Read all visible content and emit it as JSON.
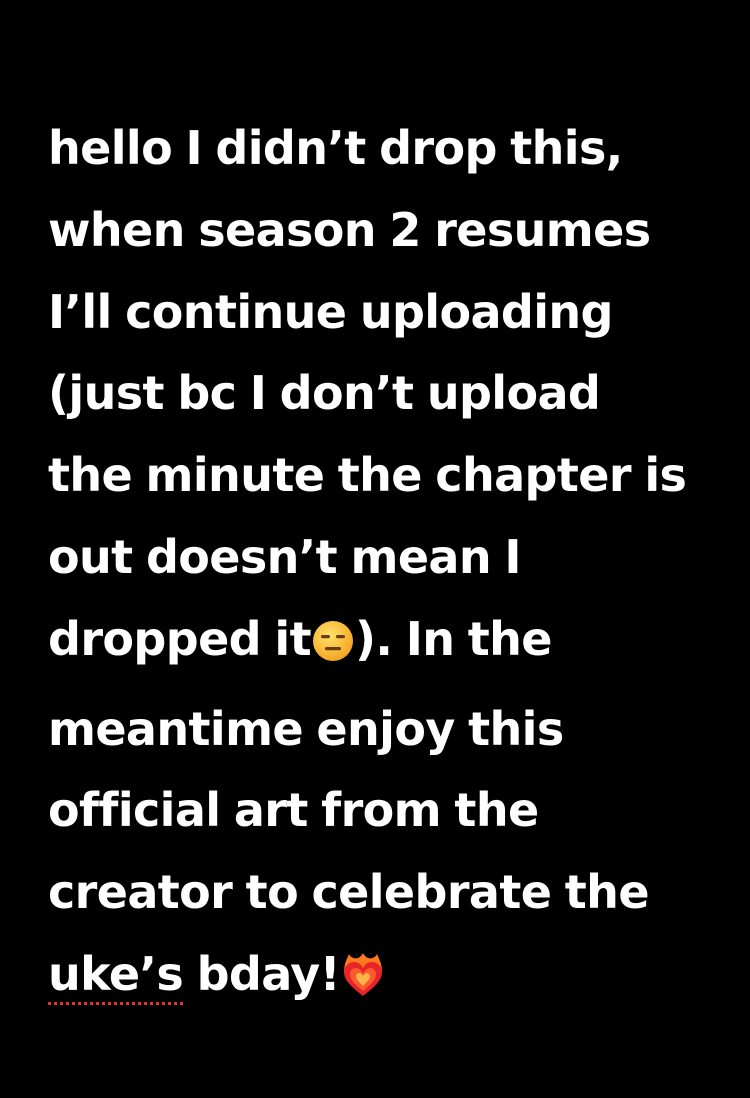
{
  "note": {
    "lines": [
      "hello I didn’t drop this,",
      "when season 2 resumes",
      "I’ll continue uploading",
      "(just bc I don’t upload",
      "the minute the chapter is",
      "out doesn’t mean I"
    ],
    "line7_before": "dropped it",
    "line7_after": "). In the",
    "line8": "meantime enjoy this",
    "line9": "official art from the",
    "line10": "creator to celebrate the",
    "line11_word": "uke’s",
    "line11_rest": " bday!"
  },
  "icons": {
    "expressionless_face": "expressionless-face-emoji",
    "heart_on_fire": "heart-on-fire-emoji"
  },
  "colors": {
    "background": "#000000",
    "text": "#ffffff",
    "spellcheck_underline": "#e0352b"
  }
}
